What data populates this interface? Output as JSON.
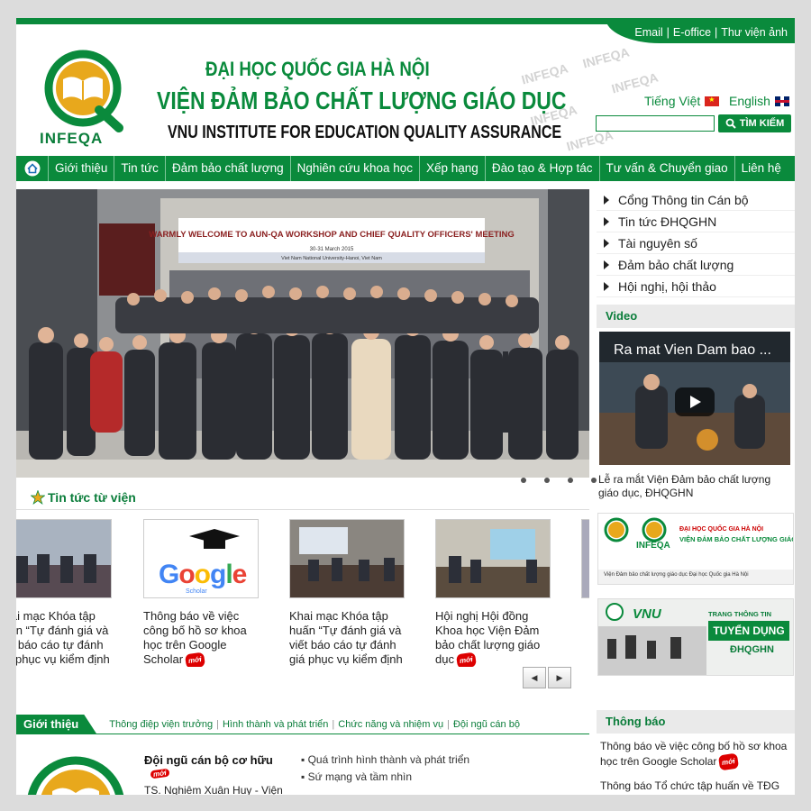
{
  "top_links": [
    "Email",
    "E-office",
    "Thư viện ảnh"
  ],
  "header": {
    "logo_text": "INFEQA",
    "title_line1": "ĐẠI HỌC QUỐC GIA HÀ NỘI",
    "title_line2": "VIỆN ĐẢM BẢO CHẤT LƯỢNG GIÁO DỤC",
    "title_line3": "VNU INSTITUTE FOR EDUCATION QUALITY ASSURANCE",
    "lang_vi": "Tiếng Việt",
    "lang_en": "English",
    "search_placeholder": "",
    "search_button": "TÌM KIẾM"
  },
  "nav": [
    "Giới thiệu",
    "Tin tức",
    "Đảm bảo chất lượng",
    "Nghiên cứu khoa học",
    "Xếp hạng",
    "Đào tạo & Hợp tác",
    "Tư vấn & Chuyển giao",
    "Liên hệ"
  ],
  "slider": {
    "banner_text": "WARMLY WELCOME TO AUN-QA WORKSHOP AND CHIEF QUALITY OFFICERS' MEETING",
    "banner_date": "30-31 March 2015",
    "banner_place": "Viet Nam National University-Hanoi, Viet Nam"
  },
  "right_links": [
    "Cổng Thông tin Cán bộ",
    "Tin tức ĐHQGHN",
    "Tài nguyên số",
    "Đảm bảo chất lượng",
    "Hội nghị, hội thảo"
  ],
  "video": {
    "heading": "Video",
    "title": "Ra mat Vien Dam bao ...",
    "caption": "Lễ ra mắt Viện Đảm bảo chất lượng giáo dục, ĐHQGHN"
  },
  "banner1": {
    "title1": "ĐẠI HỌC QUỐC GIA HÀ NỘI",
    "title2": "VIỆN ĐẢM BẢO CHẤT LƯỢNG GIÁO DỤC",
    "small": "Viện Đảm bảo chất lượng giáo dục  Đại học Quốc gia Hà Nội"
  },
  "banner2": {
    "brand": "VNU",
    "line1": "TRANG THÔNG TIN",
    "line2": "TUYỂN DỤNG",
    "line3": "ĐHQGHN"
  },
  "news": {
    "heading": "Tin tức từ viện",
    "new_badge": "mới",
    "items": [
      {
        "caption": "Khai mạc Khóa tập huấn “Tự đánh giá và viết báo cáo tự đánh giá phục vụ kiểm định",
        "new": false
      },
      {
        "caption": "Thông báo về việc công bố hồ sơ khoa học trên Google Scholar",
        "new": true
      },
      {
        "caption": "Khai mạc Khóa tập huấn “Tự đánh giá và viết báo cáo tự đánh giá phục vụ kiểm định",
        "new": false
      },
      {
        "caption": "Hội nghị Hội đồng Khoa học Viện Đảm bảo chất lượng giáo dục",
        "new": true
      }
    ],
    "google_text": "Google",
    "google_sub": "Scholar"
  },
  "intro": {
    "tab": "Giới thiệu",
    "links": [
      "Thông điệp viện trưởng",
      "Hình thành và phát triển",
      "Chức năng và nhiệm vụ",
      "Đội ngũ cán bộ"
    ],
    "staff_title": "Đội ngũ cán bộ cơ hữu",
    "staff_line": "TS. Nghiêm Xuân Huy - Viện",
    "bullets": [
      "Quá trình hình thành và phát triển",
      "Sứ mạng và tầm nhìn"
    ]
  },
  "notices": {
    "heading": "Thông báo",
    "items": [
      "Thông báo về việc công bố hồ sơ khoa học trên Google Scholar",
      "Thông báo Tổ chức tập huấn về TĐG và"
    ]
  },
  "watermark": "INFEQA",
  "colors": {
    "brand_green": "#0a8a3c",
    "new_red": "#dd0000"
  }
}
